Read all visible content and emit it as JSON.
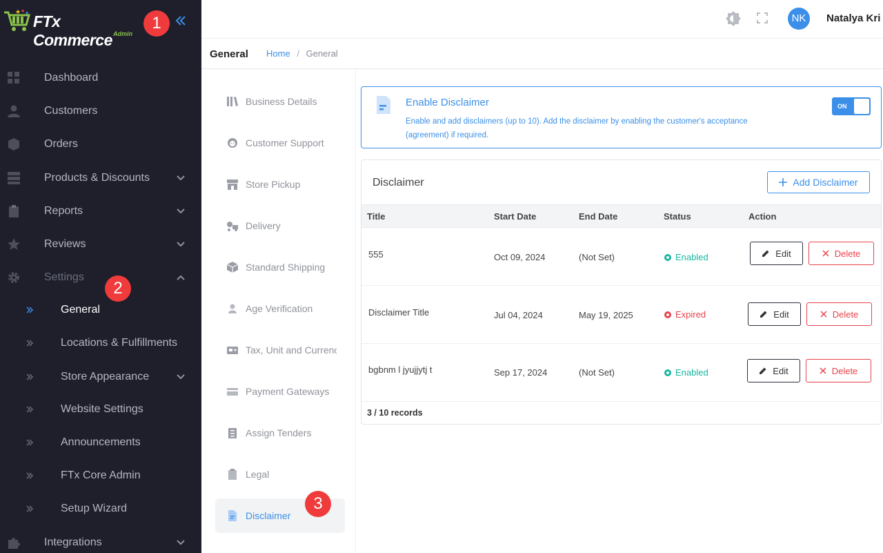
{
  "app": {
    "logo_text": "FTx Commerce",
    "logo_sub": "Admin"
  },
  "markers": [
    "1",
    "2",
    "3"
  ],
  "sidebar": {
    "items": [
      {
        "label": "Dashboard",
        "icon": "dashboard-icon"
      },
      {
        "label": "Customers",
        "icon": "person-icon"
      },
      {
        "label": "Orders",
        "icon": "cube-icon"
      },
      {
        "label": "Products & Discounts",
        "icon": "server-icon"
      },
      {
        "label": "Reports",
        "icon": "clipboard-icon"
      },
      {
        "label": "Reviews",
        "icon": "star-icon"
      },
      {
        "label": "Settings",
        "icon": "gear-icon"
      }
    ],
    "settings_sub": [
      {
        "label": "General"
      },
      {
        "label": "Locations & Fulfillments"
      },
      {
        "label": "Store Appearance"
      },
      {
        "label": "Website Settings"
      },
      {
        "label": "Announcements"
      },
      {
        "label": "FTx Core Admin"
      },
      {
        "label": "Setup Wizard"
      }
    ],
    "integrations": "Integrations"
  },
  "topbar": {
    "avatar_initials": "NK",
    "user_name": "Natalya Kri"
  },
  "breadcrumb": {
    "page_title": "General",
    "home": "Home",
    "separator": "/",
    "current": "General"
  },
  "submenu": [
    {
      "label": "Business Details"
    },
    {
      "label": "Customer Support"
    },
    {
      "label": "Store Pickup"
    },
    {
      "label": "Delivery"
    },
    {
      "label": "Standard Shipping"
    },
    {
      "label": "Age Verification"
    },
    {
      "label": "Tax, Unit and Currency"
    },
    {
      "label": "Payment Gateways"
    },
    {
      "label": "Assign Tenders"
    },
    {
      "label": "Legal"
    },
    {
      "label": "Disclaimer"
    }
  ],
  "banner": {
    "title": "Enable Disclaimer",
    "description": "Enable and add disclaimers (up to 10). Add the disclaimer by enabling the customer's acceptance (agreement) if required.",
    "toggle_label": "ON",
    "enabled": true
  },
  "disclaimer": {
    "title": "Disclaimer",
    "add_label": "Add Disclaimer",
    "columns": [
      "Title",
      "Start Date",
      "End Date",
      "Status",
      "Action"
    ],
    "rows": [
      {
        "title": "555",
        "start": "Oct 09, 2024",
        "end": "(Not Set)",
        "status": "Enabled",
        "edit": "Edit",
        "delete": "Delete"
      },
      {
        "title": "Disclaimer Title",
        "start": "Jul 04, 2024",
        "end": "May 19, 2025",
        "status": "Expired",
        "edit": "Edit",
        "delete": "Delete"
      },
      {
        "title": "bgbnm l jyujjytj t",
        "start": "Sep 17, 2024",
        "end": "(Not Set)",
        "status": "Enabled",
        "edit": "Edit",
        "delete": "Delete"
      }
    ],
    "records": "3 / 10 records"
  }
}
